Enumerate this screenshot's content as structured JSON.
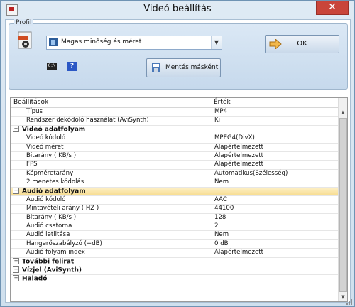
{
  "window": {
    "title": "Videó beállítás",
    "close_glyph": "✕"
  },
  "profil": {
    "group_label": "Profil",
    "profile_value": "Magas minőség és méret",
    "ok_label": "OK",
    "save_as_label": "Mentés másként",
    "cli_icon_text": "C:\\",
    "help_icon_text": "?"
  },
  "grid": {
    "col_settings": "Beállítások",
    "col_value": "Érték",
    "rows": [
      {
        "k": "Típus",
        "v": "MP4"
      },
      {
        "k": "Rendszer dekódoló használat (AviSynth)",
        "v": "Ki"
      },
      {
        "k": "Videó adatfolyam",
        "v": "",
        "cat": true,
        "exp": "−"
      },
      {
        "k": "Videó kódoló",
        "v": "MPEG4(DivX)"
      },
      {
        "k": "Videó méret",
        "v": "Alapértelmezett"
      },
      {
        "k": "Bitarány ( KB/s )",
        "v": "Alapértelmezett"
      },
      {
        "k": "FPS",
        "v": "Alapértelmezett"
      },
      {
        "k": "Képméretarány",
        "v": "Automatikus(Szélesség)"
      },
      {
        "k": "2 menetes kódolás",
        "v": "Nem"
      },
      {
        "k": "Audió adatfolyam",
        "v": "",
        "cat": true,
        "exp": "−",
        "hl": true
      },
      {
        "k": "Audió kódoló",
        "v": "AAC"
      },
      {
        "k": "Mintavételi arány ( HZ )",
        "v": "44100"
      },
      {
        "k": "Bitarány ( KB/s )",
        "v": "128"
      },
      {
        "k": "Audió csatorna",
        "v": "2"
      },
      {
        "k": "Audió letiltása",
        "v": "Nem"
      },
      {
        "k": "Hangerőszabályzó (+dB)",
        "v": "0 dB"
      },
      {
        "k": "Audió folyam index",
        "v": "Alapértelmezett"
      },
      {
        "k": "További felirat",
        "v": "",
        "cat": true,
        "exp": "+"
      },
      {
        "k": "Vízjel (AviSynth)",
        "v": "",
        "cat": true,
        "exp": "+"
      },
      {
        "k": "Haladó",
        "v": "",
        "cat": true,
        "exp": "+"
      }
    ]
  }
}
